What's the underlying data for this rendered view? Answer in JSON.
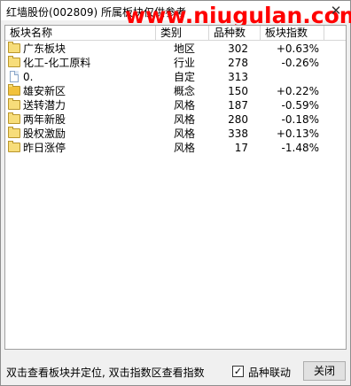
{
  "window": {
    "title": "红墙股份(002809)  所属板块仅供参考",
    "watermark": "www.niugulan.com",
    "close_glyph": "✕"
  },
  "table": {
    "columns": [
      "板块名称",
      "类别",
      "品种数",
      "板块指数"
    ],
    "rows": [
      {
        "icon": "folder-icon",
        "name": "广东板块",
        "category": "地区",
        "count": "302",
        "index": "+0.63%"
      },
      {
        "icon": "folder-icon",
        "name": "化工-化工原料",
        "category": "行业",
        "count": "278",
        "index": "-0.26%"
      },
      {
        "icon": "document-icon",
        "name": "0.",
        "category": "自定",
        "count": "313",
        "index": ""
      },
      {
        "icon": "folder-filled-icon",
        "name": "雄安新区",
        "category": "概念",
        "count": "150",
        "index": "+0.22%"
      },
      {
        "icon": "folder-icon",
        "name": "送转潜力",
        "category": "风格",
        "count": "187",
        "index": "-0.59%"
      },
      {
        "icon": "folder-icon",
        "name": "两年新股",
        "category": "风格",
        "count": "280",
        "index": "-0.18%"
      },
      {
        "icon": "folder-icon",
        "name": "股权激励",
        "category": "风格",
        "count": "338",
        "index": "+0.13%"
      },
      {
        "icon": "folder-icon",
        "name": "昨日涨停",
        "category": "风格",
        "count": "17",
        "index": "-1.48%"
      }
    ]
  },
  "footer": {
    "hint": "双击查看板块并定位, 双击指数区查看指数",
    "checkbox_label": "品种联动",
    "checkbox_checked": true,
    "close_button": "关闭"
  }
}
